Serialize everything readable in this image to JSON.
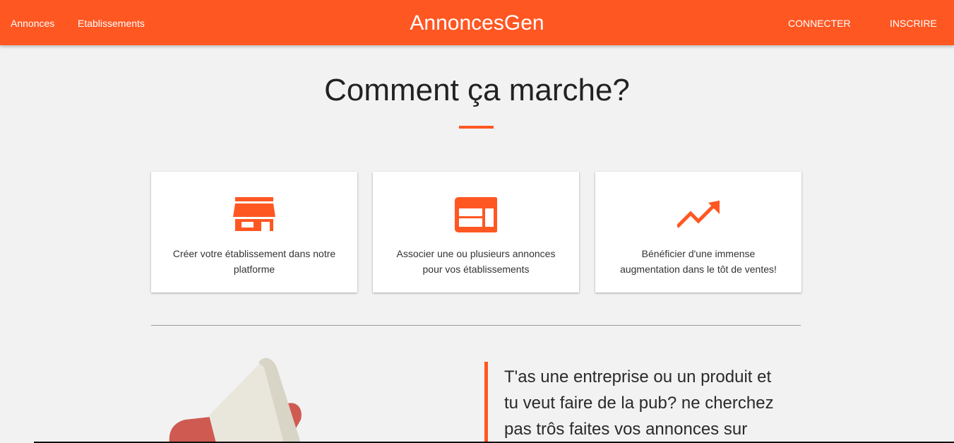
{
  "navbar": {
    "left_links": [
      "Annonces",
      "Etablissements"
    ],
    "brand": "AnnoncesGen",
    "connect_label": "CONNECTER",
    "register_label": "INSCRIRE"
  },
  "section": {
    "title": "Comment ça marche?"
  },
  "cards": [
    {
      "icon": "store-icon",
      "line1": "Créer votre établissement dans notre",
      "line2": "platforme"
    },
    {
      "icon": "web-layout-icon",
      "line1": "Associer une ou plusieurs annonces",
      "line2": "pour vos établissements"
    },
    {
      "icon": "trending-up-icon",
      "line1": "Bénéficier d'une immense",
      "line2": "augmentation dans le tôt de ventes!"
    }
  ],
  "promo": {
    "line1": "T'as une entreprise ou un produit et",
    "line2": "tu veut faire de la pub? ne cherchez",
    "line3": "pas trôs faites vos annonces sur"
  },
  "colors": {
    "accent": "#ff5722",
    "background": "#f2f2f2"
  }
}
